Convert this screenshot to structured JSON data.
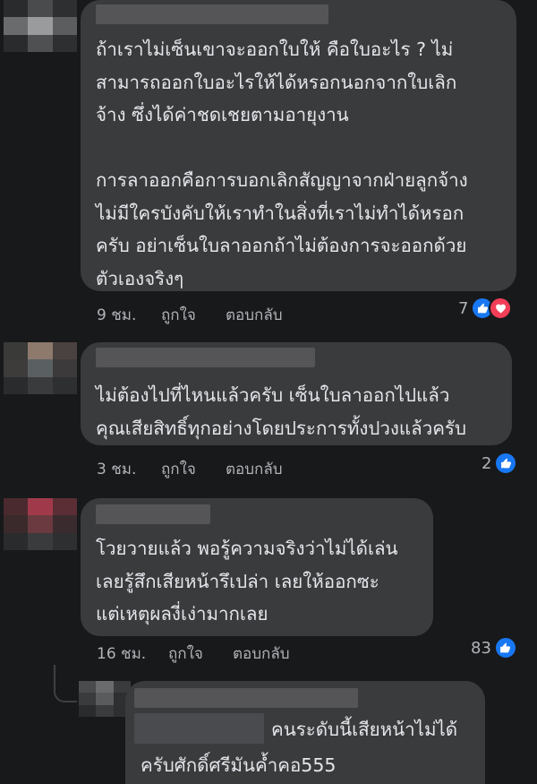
{
  "comments": [
    {
      "text": "ถ้าเราไม่เซ็นเขาจะออกใบให้ คือใบอะไร ? ไม่\nสามารถออกใบอะไรให้ได้หรอกนอกจากใบเลิก\nจ้าง ซึ่งได้ค่าชดเชยตามอายุงาน\n\nการลาออกคือการบอกเลิกสัญญาจากฝ่ายลูกจ้าง\nไม่มีใครบังคับให้เราทำในสิ่งที่เราไม่ทำได้หรอก\nครับ อย่าเซ็นใบลาออกถ้าไม่ต้องการจะออกด้วย\nตัวเองจริงๆ",
      "time": "9 ชม.",
      "like_label": "ถูกใจ",
      "reply_label": "ตอบกลับ",
      "reaction_count": "7",
      "reactions": [
        "like-icon",
        "love-icon"
      ]
    },
    {
      "text": "ไม่ต้องไปที่ไหนแล้วครับ เซ็นใบลาออกไปแล้ว\nคุณเสียสิทธิ์ทุกอย่างโดยประการทั้งปวงแล้วครับ",
      "time": "3 ชม.",
      "like_label": "ถูกใจ",
      "reply_label": "ตอบกลับ",
      "reaction_count": "2",
      "reactions": [
        "like-icon"
      ]
    },
    {
      "text": "โวยวายแล้ว พอรู้ความจริงว่าไม่ได้เล่น\nเลยรู้สึกเสียหน้ารึเปล่า เลยให้ออกซะ\nแต่เหตุผลงี่เง่ามากเลย",
      "time": "16 ชม.",
      "like_label": "ถูกใจ",
      "reply_label": "ตอบกลับ",
      "reaction_count": "83",
      "reactions": [
        "like-icon"
      ]
    }
  ],
  "reply": {
    "text_line1": "คนระดับนี้เสียหน้าไม่ได้",
    "text_line2": "ครับศักดิ์ศรีมันค้ำคอ555"
  },
  "colors": {
    "background": "#18191a",
    "bubble": "#3a3b3c",
    "text": "#e4e6eb",
    "meta": "#b0b3b8",
    "like": "#1877f2",
    "love": "#f33e58"
  }
}
